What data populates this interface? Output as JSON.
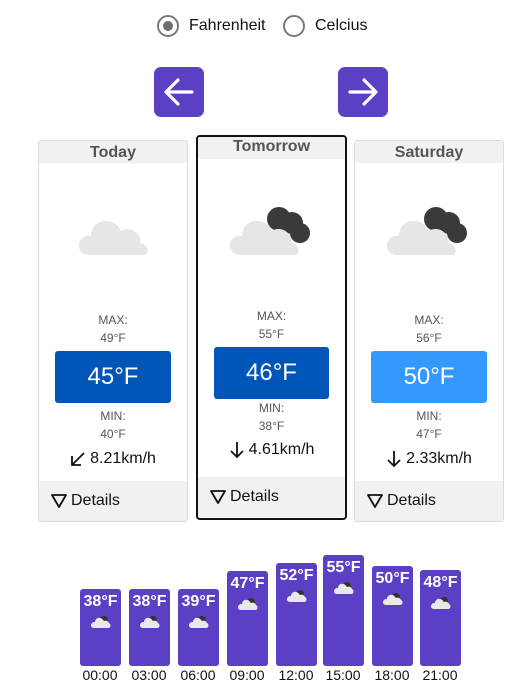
{
  "units": {
    "options": [
      {
        "label": "Fahrenheit",
        "checked": true
      },
      {
        "label": "Celcius",
        "checked": false
      }
    ]
  },
  "nav": {
    "prev_icon": "arrow-left-icon",
    "next_icon": "arrow-right-icon"
  },
  "colors": {
    "accent": "#5b3fc4",
    "dark_blue": "#0055b8",
    "light_blue": "#3399ff"
  },
  "cards": [
    {
      "day": "Today",
      "icon": "cloud-icon",
      "max_label": "MAX:",
      "max": "49°F",
      "current": "45°F",
      "min_label": "MIN:",
      "min": "40°F",
      "wind": "8.21km/h",
      "wind_icon": "arrow-down-left-icon",
      "details": "Details"
    },
    {
      "day": "Tomorrow",
      "icon": "cloud-dark-icon",
      "max_label": "MAX:",
      "max": "55°F",
      "current": "46°F",
      "min_label": "MIN:",
      "min": "38°F",
      "wind": "4.61km/h",
      "wind_icon": "arrow-down-icon",
      "details": "Details"
    },
    {
      "day": "Saturday",
      "icon": "cloud-dark-icon",
      "max_label": "MAX:",
      "max": "56°F",
      "current": "50°F",
      "min_label": "MIN:",
      "min": "47°F",
      "wind": "2.33km/h",
      "wind_icon": "arrow-down-icon",
      "details": "Details"
    }
  ],
  "hourly": [
    {
      "temp": "38°F",
      "time": "00:00"
    },
    {
      "temp": "38°F",
      "time": "03:00"
    },
    {
      "temp": "39°F",
      "time": "06:00"
    },
    {
      "temp": "47°F",
      "time": "09:00"
    },
    {
      "temp": "52°F",
      "time": "12:00"
    },
    {
      "temp": "55°F",
      "time": "15:00"
    },
    {
      "temp": "50°F",
      "time": "18:00"
    },
    {
      "temp": "48°F",
      "time": "21:00"
    }
  ]
}
